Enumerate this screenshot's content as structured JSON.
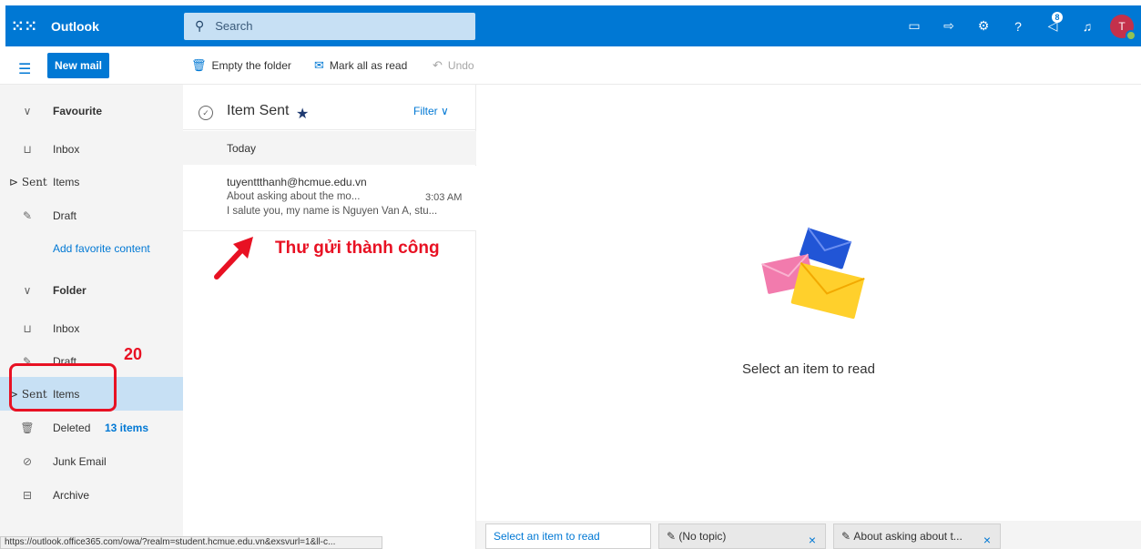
{
  "app": {
    "name": "Outlook"
  },
  "search": {
    "placeholder": "Search"
  },
  "topbar": {
    "notification_count": "8",
    "avatar_initial": "T"
  },
  "toolbar": {
    "new_mail": "New mail",
    "empty_folder": "Empty the folder",
    "mark_all_read": "Mark all as read",
    "undo": "Undo"
  },
  "nav": {
    "favourite": "Favourite",
    "fav_items": [
      {
        "label": "Inbox",
        "icon": "inbox-icon"
      },
      {
        "prefix": "Sent",
        "label": "Items",
        "icon": "send-icon"
      },
      {
        "label": "Draft",
        "icon": "pencil-icon"
      }
    ],
    "add_favorite": "Add favorite content",
    "folder": "Folder",
    "folder_items": [
      {
        "label": "Inbox",
        "icon": "inbox-icon"
      },
      {
        "label": "Draft",
        "icon": "pencil-icon"
      },
      {
        "prefix": "Sent",
        "label": "Items",
        "icon": "send-icon",
        "selected": true
      },
      {
        "label": "Deleted",
        "count": "13 items",
        "icon": "trash-icon"
      },
      {
        "label": "Junk Email",
        "icon": "block-icon"
      },
      {
        "label": "Archive",
        "icon": "archive-icon"
      }
    ]
  },
  "message_list": {
    "title": "Item Sent",
    "filter": "Filter",
    "group": "Today",
    "items": [
      {
        "from": "tuyenttthanh@hcmue.edu.vn",
        "subject": "About asking about the mo...",
        "time": "3:03 AM",
        "preview": "I salute you, my name is Nguyen Van A, stu..."
      }
    ]
  },
  "annotations": {
    "step_number": "20",
    "success_text": "Thư gửi thành công",
    "accent": "#e81123"
  },
  "reading_pane": {
    "empty_message": "Select an item to read"
  },
  "bottom_tabs": [
    {
      "label": "Select an item to read",
      "active": true
    },
    {
      "label": "(No topic)"
    },
    {
      "label": "About asking about t..."
    }
  ],
  "status_url": "https://outlook.office365.com/owa/?realm=student.hcmue.edu.vn&exsvurl=1&ll-c...",
  "colors": {
    "brand": "#0078d4",
    "search_bg": "#c7e0f4",
    "selected_bg": "#c7e0f4",
    "annotation": "#e81123"
  }
}
